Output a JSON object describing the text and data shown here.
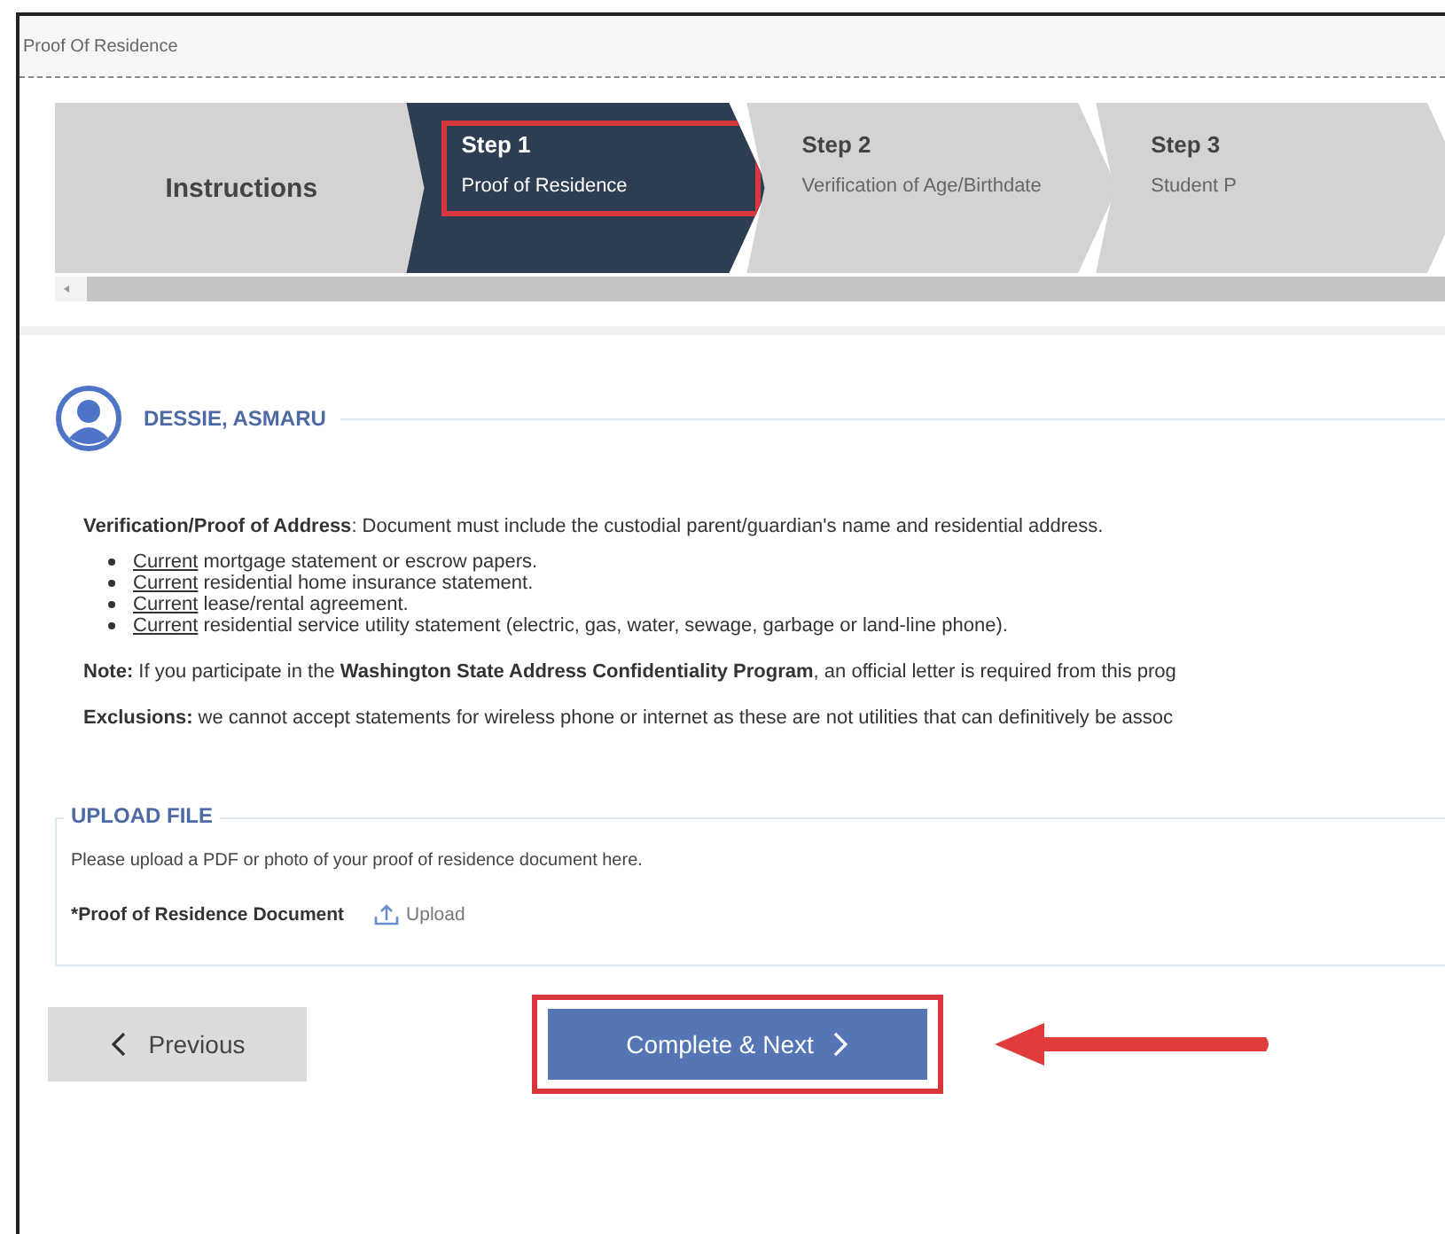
{
  "window": {
    "title": "Proof Of Residence"
  },
  "steps": [
    {
      "kind": "intro",
      "label": "Instructions",
      "selected": false,
      "highlighted": false
    },
    {
      "kind": "step",
      "number": "Step 1",
      "label": "Proof of Residence",
      "selected": true,
      "highlighted": true
    },
    {
      "kind": "step",
      "number": "Step 2",
      "label": "Verification of Age/Birthdate",
      "selected": false,
      "highlighted": false
    },
    {
      "kind": "step",
      "number": "Step 3",
      "label": "Student P",
      "selected": false,
      "highlighted": false
    }
  ],
  "student": {
    "name": "DESSIE, ASMARU"
  },
  "intro": "**Verification/Proof of Address**: Document must include the custodial parent/guardian's name and residential address.",
  "requirements": [
    {
      "link": "Current",
      "text": "mortgage statement or escrow papers."
    },
    {
      "link": "Current",
      "text": "residential home insurance statement."
    },
    {
      "link": "Current",
      "text": "lease/rental agreement."
    },
    {
      "link": "Current",
      "text": "residential service utility statement (electric, gas, water, sewage, garbage or land-line phone)."
    }
  ],
  "note": "**Note:** If you participate in the **Washington State Address Confidentiality Program**, an official letter is required from this prog",
  "exclusions": "**Exclusions:** we cannot accept statements for wireless phone or internet as these are not utilities that can definitively be assoc",
  "upload": {
    "legend": "UPLOAD FILE",
    "instructions": "Please upload a PDF or photo of your proof of residence document here.",
    "field_label": "*Proof of Residence Document",
    "action": "Upload"
  },
  "buttons": [
    {
      "kind": "previous",
      "label": "Previous",
      "highlighted": false
    },
    {
      "kind": "next",
      "label": "Complete & Next",
      "highlighted": true
    }
  ],
  "callout_arrow": true
}
